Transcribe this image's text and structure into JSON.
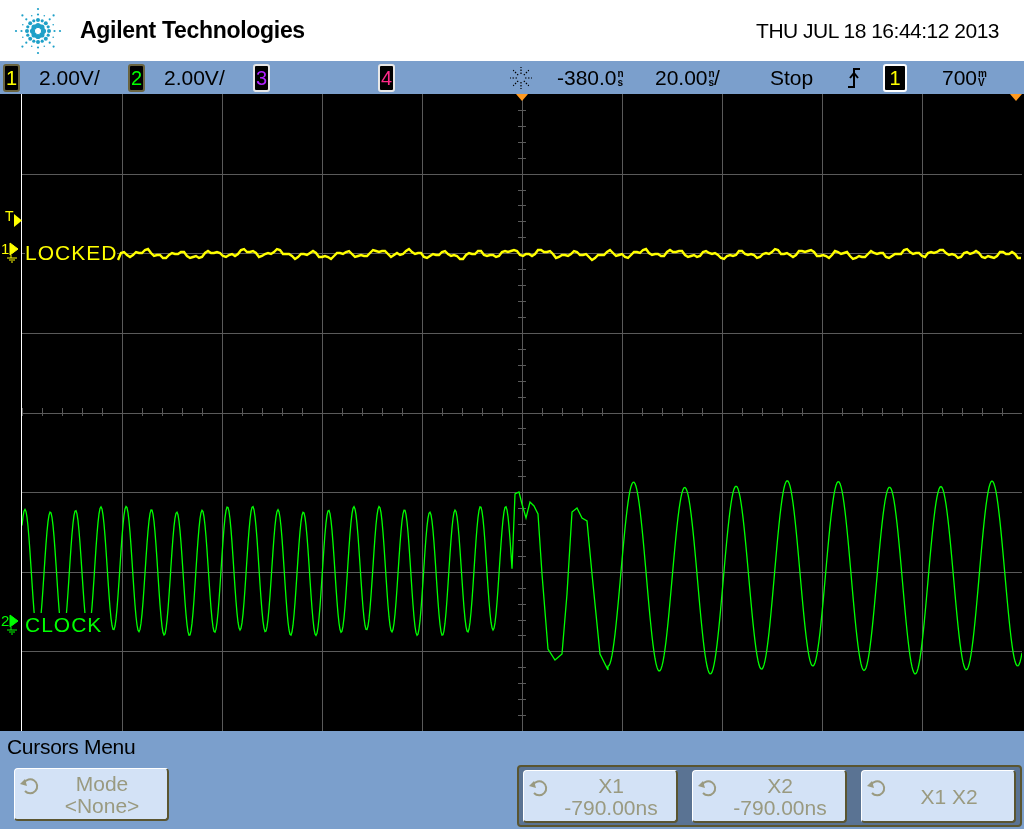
{
  "header": {
    "brand": "Agilent Technologies",
    "datetime": "THU JUL 18 16:44:12 2013"
  },
  "status_bar": {
    "channels": [
      {
        "number": "1",
        "scale": "2.00V/"
      },
      {
        "number": "2",
        "scale": "2.00V/"
      },
      {
        "number": "3"
      },
      {
        "number": "4"
      }
    ],
    "delay": {
      "value": "-380.0",
      "unit": "ns"
    },
    "timebase": {
      "value": "20.00",
      "unit": "ns",
      "suffix": "/"
    },
    "run_state": "Stop",
    "trigger": {
      "source": "1",
      "level": {
        "value": "700",
        "unit": "mV"
      }
    }
  },
  "display": {
    "trigger_marker": "T",
    "traces": [
      {
        "number": "1",
        "label": "LOCKED",
        "color": "#ffff00",
        "kind": "level"
      },
      {
        "number": "2",
        "label": "CLOCK",
        "color": "#00ff00",
        "kind": "clock"
      }
    ]
  },
  "menu": {
    "title": "Cursors Menu",
    "softkeys": [
      {
        "lines": [
          "Mode",
          "<None>"
        ],
        "grouped": false
      },
      {
        "lines": [
          "X1",
          "-790.00ns"
        ],
        "grouped": true
      },
      {
        "lines": [
          "X2",
          "-790.00ns"
        ],
        "grouped": true
      },
      {
        "lines": [
          "X1 X2"
        ],
        "grouped": true
      }
    ]
  }
}
